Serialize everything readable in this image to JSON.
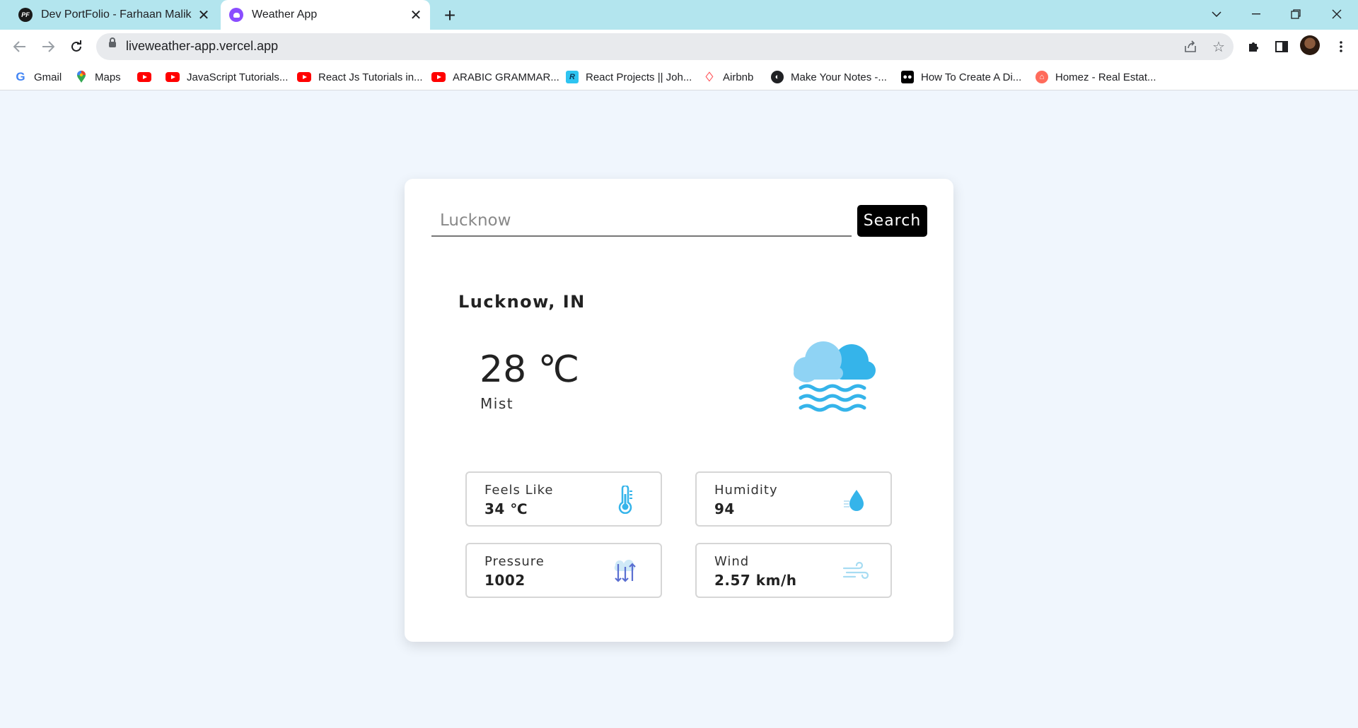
{
  "browser": {
    "tabs": [
      {
        "title": "Dev PortFolio - Farhaan Malik",
        "favicon": "PF"
      },
      {
        "title": "Weather App"
      }
    ],
    "url": "liveweather-app.vercel.app",
    "bookmarks": [
      {
        "label": "Gmail",
        "icon": "google-icon"
      },
      {
        "label": "Maps",
        "icon": "maps-pin-icon"
      },
      {
        "label": "",
        "icon": "youtube-icon"
      },
      {
        "label": "JavaScript Tutorials...",
        "icon": "youtube-icon"
      },
      {
        "label": "React Js Tutorials in...",
        "icon": "youtube-icon"
      },
      {
        "label": "ARABIC GRAMMAR...",
        "icon": "youtube-icon"
      },
      {
        "label": "React Projects || Joh...",
        "icon": "r-icon"
      },
      {
        "label": "Airbnb",
        "icon": "airbnb-icon"
      },
      {
        "label": "Make Your Notes -...",
        "icon": "globe-icon"
      },
      {
        "label": "How To Create A Di...",
        "icon": "medium-icon"
      },
      {
        "label": "Homez - Real Estat...",
        "icon": "homez-icon"
      }
    ]
  },
  "weather": {
    "search": {
      "placeholder": "Lucknow",
      "button_label": "Search"
    },
    "location": "Lucknow, IN",
    "temperature": "28 ℃",
    "condition": "Mist",
    "condition_icon": "mist-cloud-icon",
    "stats": {
      "feels_like": {
        "label": "Feels Like",
        "value": "34 ℃",
        "icon": "thermometer-icon"
      },
      "humidity": {
        "label": "Humidity",
        "value": "94",
        "icon": "water-drop-icon"
      },
      "pressure": {
        "label": "Pressure",
        "value": "1002",
        "icon": "pressure-arrows-icon"
      },
      "wind": {
        "label": "Wind",
        "value": "2.57 km/h",
        "icon": "wind-icon"
      }
    },
    "colors": {
      "accent": "#3bb5e8",
      "button": "#000000",
      "page_bg": "#f0f6fd"
    }
  }
}
